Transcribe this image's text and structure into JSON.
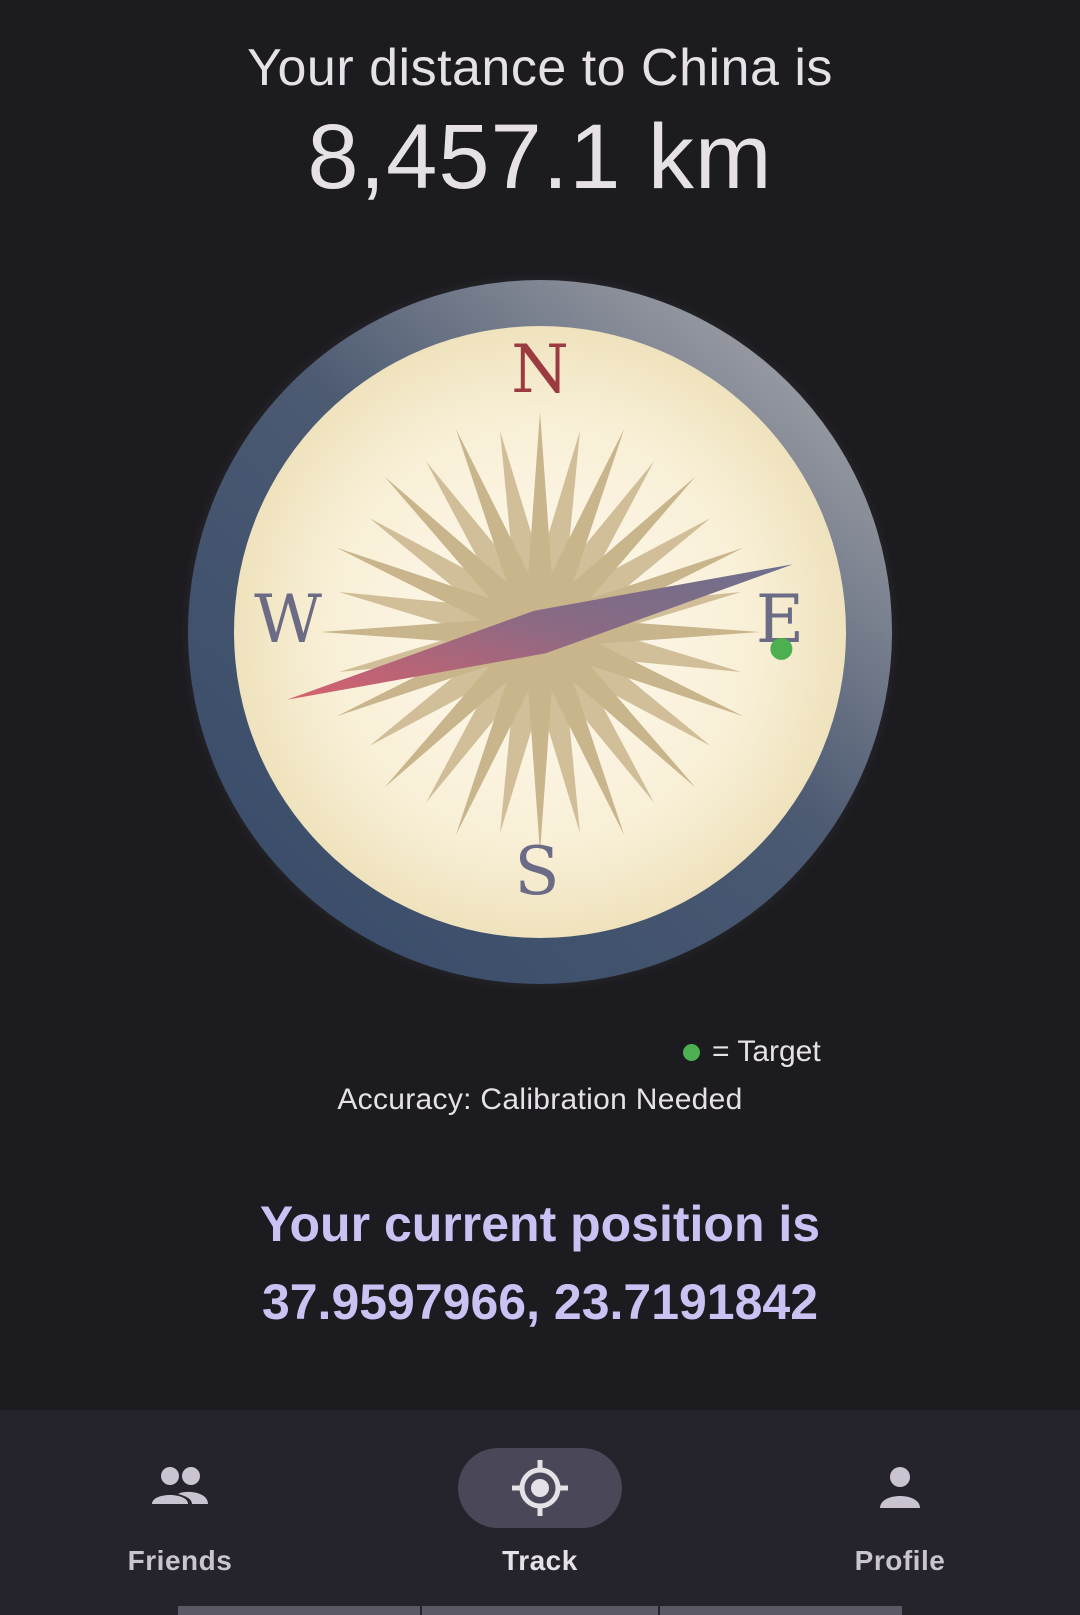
{
  "header": {
    "headline": "Your distance to China is",
    "distance": "8,457.1 km"
  },
  "compass": {
    "north_label": "N",
    "south_label": "S",
    "east_label": "E",
    "west_label": "W",
    "needle_bearing_deg": 75,
    "target_bearing_deg": 94,
    "colors": {
      "north_letter": "#9b3a40",
      "other_letters": "#6b6b85",
      "rose": "#c9b58c",
      "needle_tip": "#7d6e8c",
      "needle_tail": "#d06272",
      "target_dot": "#4caf50",
      "bezel_dark": "#3e5270",
      "bezel_light": "#8a8d96"
    }
  },
  "legend": {
    "target_label": "= Target"
  },
  "accuracy": "Accuracy: Calibration Needed",
  "position": {
    "title": "Your current position is",
    "coordinates": "37.9597966, 23.7191842"
  },
  "nav": {
    "items": [
      {
        "label": "Friends",
        "icon": "group-icon",
        "active": false
      },
      {
        "label": "Track",
        "icon": "gps-target-icon",
        "active": true
      },
      {
        "label": "Profile",
        "icon": "person-icon",
        "active": false
      }
    ]
  }
}
